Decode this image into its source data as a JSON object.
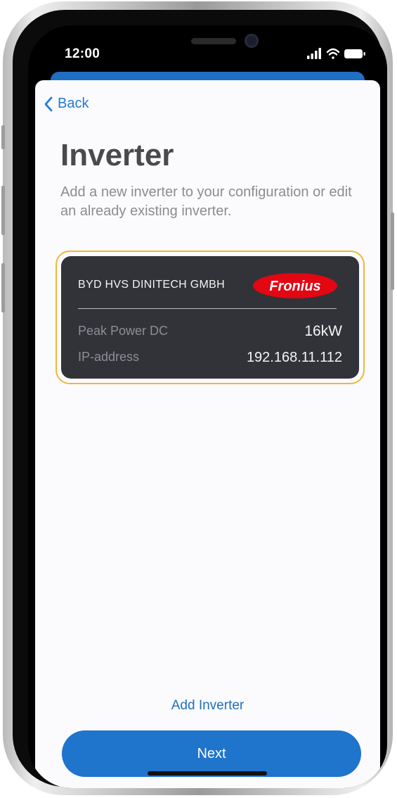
{
  "status_bar": {
    "time": "12:00"
  },
  "nav": {
    "back_label": "Back"
  },
  "page": {
    "title": "Inverter",
    "subtitle": "Add a new inverter to your configuration or edit an already existing inverter."
  },
  "inverter_card": {
    "name": "BYD HVS DINITECH GMBH",
    "brand": "Fronius",
    "rows": [
      {
        "label": "Peak Power DC",
        "value": "16kW"
      },
      {
        "label": "IP-address",
        "value": "192.168.11.112"
      }
    ]
  },
  "actions": {
    "add_label": "Add Inverter",
    "next_label": "Next"
  },
  "colors": {
    "accent": "#1f74cc",
    "card_background": "#323239",
    "selection_outline": "#f2b63a",
    "brand_red": "#e30613"
  }
}
